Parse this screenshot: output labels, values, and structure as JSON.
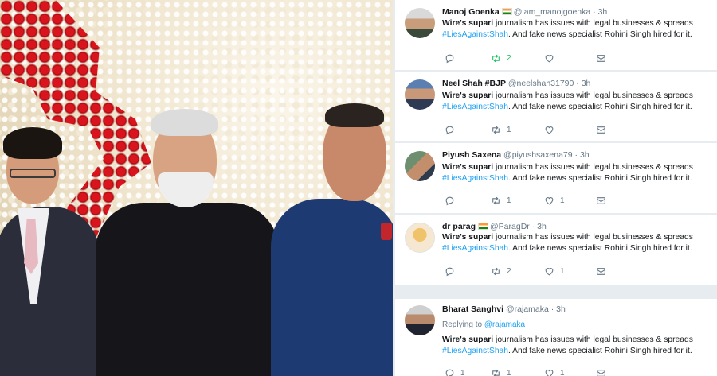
{
  "tweets": [
    {
      "name": "Manoj Goenka",
      "flag": true,
      "handle": "@iam_manojgoenka",
      "time": "· 3h",
      "reply_prefix": "",
      "reply_to": "",
      "bold": "Wire's supari",
      "text1": " journalism has issues with legal businesses & spreads",
      "hashtag": "#LiesAgainstShah",
      "text2": ". And fake news specialist Rohini Singh hired for it.",
      "reply_count": "",
      "retweet_count": "2",
      "like_count": "",
      "retweeted": true
    },
    {
      "name": "Neel Shah #BJP",
      "flag": false,
      "handle": "@neelshah31790",
      "time": "· 3h",
      "reply_prefix": "",
      "reply_to": "",
      "bold": "Wire's supari",
      "text1": " journalism has issues with legal businesses & spreads",
      "hashtag": "#LiesAgainstShah",
      "text2": ". And fake news specialist Rohini Singh hired for it.",
      "reply_count": "",
      "retweet_count": "1",
      "like_count": "",
      "retweeted": false
    },
    {
      "name": "Piyush Saxena",
      "flag": false,
      "handle": "@piyushsaxena79",
      "time": "· 3h",
      "reply_prefix": "",
      "reply_to": "",
      "bold": "Wire's supari",
      "text1": " journalism has issues with legal businesses & spreads",
      "hashtag": "#LiesAgainstShah",
      "text2": ". And fake news specialist Rohini Singh hired for it.",
      "reply_count": "",
      "retweet_count": "1",
      "like_count": "1",
      "retweeted": false
    },
    {
      "name": "dr parag",
      "flag": true,
      "handle": "@ParagDr",
      "time": "· 3h",
      "reply_prefix": "",
      "reply_to": "",
      "bold": "Wire's supari",
      "text1": " journalism has issues with legal businesses & spreads",
      "hashtag": "#LiesAgainstShah",
      "text2": ". And fake news specialist Rohini Singh hired for it.",
      "reply_count": "",
      "retweet_count": "2",
      "like_count": "1",
      "retweeted": false
    },
    {
      "name": "Bharat Sanghvi",
      "flag": false,
      "handle": "@rajamaka",
      "time": "· 3h",
      "reply_prefix": "Replying to ",
      "reply_to": "@rajamaka",
      "bold": "Wire's supari",
      "text1": " journalism has issues with legal businesses & spreads",
      "hashtag": "#LiesAgainstShah",
      "text2": ". And fake news specialist Rohini Singh hired for it.",
      "reply_count": "1",
      "retweet_count": "1",
      "like_count": "1",
      "retweeted": false
    }
  ],
  "colors": {
    "link": "#1da1f2",
    "muted": "#657786",
    "retweet_active": "#17bf63",
    "background": "#e6ecf0"
  },
  "icons": [
    "reply-icon",
    "retweet-icon",
    "like-icon",
    "direct-message-icon"
  ]
}
